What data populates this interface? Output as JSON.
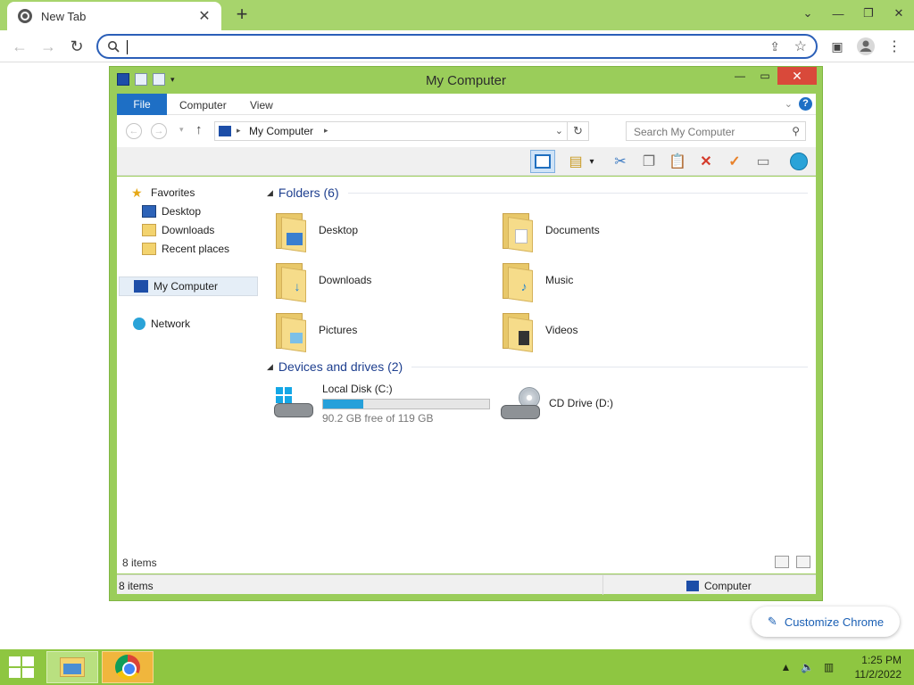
{
  "browser": {
    "tab_title": "New Tab",
    "omnibox_value": "",
    "customize_label": "Customize Chrome"
  },
  "explorer": {
    "window_title": "My Computer",
    "ribbon_tabs": [
      "File",
      "Computer",
      "View"
    ],
    "address_path": "My Computer",
    "search_placeholder": "Search My Computer",
    "nav": {
      "favorites": "Favorites",
      "desktop": "Desktop",
      "downloads": "Downloads",
      "recent": "Recent places",
      "my_computer": "My Computer",
      "network": "Network"
    },
    "folders_header": "Folders (6)",
    "folders": [
      {
        "name": "Desktop",
        "icon": "folder-desktop-icon"
      },
      {
        "name": "Documents",
        "icon": "folder-documents-icon"
      },
      {
        "name": "Downloads",
        "icon": "folder-downloads-icon"
      },
      {
        "name": "Music",
        "icon": "folder-music-icon"
      },
      {
        "name": "Pictures",
        "icon": "folder-pictures-icon"
      },
      {
        "name": "Videos",
        "icon": "folder-videos-icon"
      }
    ],
    "drives_header": "Devices and drives (2)",
    "drives": [
      {
        "name": "Local Disk (C:)",
        "free_text": "90.2 GB free of 119 GB",
        "used_fraction": 0.242
      },
      {
        "name": "CD Drive (D:)"
      }
    ],
    "items_count": "8 items",
    "status_count": "8 items",
    "status_location": "Computer"
  },
  "taskbar": {
    "time": "1:25 PM",
    "date": "11/2/2022"
  },
  "colors": {
    "chrome_frame": "#a7d46c",
    "window_frame": "#9acd5a",
    "taskbar": "#8ec641",
    "accent_blue": "#1e6fc5"
  }
}
